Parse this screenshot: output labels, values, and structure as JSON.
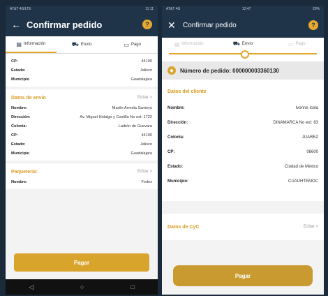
{
  "phone1": {
    "status_left": "AT&T 4G/LTE",
    "status_right": "11:11",
    "title": "Confirmar pedido",
    "tabs": [
      "Información",
      "Envío",
      "Pago"
    ],
    "address_rows": [
      {
        "k": "CP:",
        "v": "44100"
      },
      {
        "k": "Estado:",
        "v": "Jalisco"
      },
      {
        "k": "Municipio",
        "v": "Guadalajara"
      }
    ],
    "envio": {
      "title": "Datos de envío",
      "edit": "Editar >",
      "rows": [
        {
          "k": "Nombre:",
          "v": "Martín Arreola Santoyo"
        },
        {
          "k": "Dirección:",
          "v": "Av. Miguel Hidalgo y Costilla No ext: 1722"
        },
        {
          "k": "Colonia:",
          "v": "Ladrón de Guevara"
        },
        {
          "k": "CP:",
          "v": "44100"
        },
        {
          "k": "Estado:",
          "v": "Jalisco"
        },
        {
          "k": "Municipio",
          "v": "Guadalajara"
        }
      ]
    },
    "paqueteria": {
      "title": "Paquetería:",
      "edit": "Editar >",
      "rows": [
        {
          "k": "Nombre:",
          "v": "Fedex"
        }
      ]
    },
    "pay_label": "Pagar",
    "nav": [
      "◁",
      "○",
      "□"
    ]
  },
  "phone2": {
    "status_left": "AT&T 4G",
    "status_center": "12:47",
    "status_right": "20%",
    "title": "Confirmar pedido",
    "steps": [
      "Información",
      "Envío",
      "Pago"
    ],
    "order_text": "Número de pedido: 000000003360130",
    "cliente": {
      "title": "Datos del cliente",
      "rows": [
        {
          "k": "Nombre:",
          "v": "Ivonne Icela"
        },
        {
          "k": "Dirección:",
          "v": "DINAMARCA No ext: 83"
        },
        {
          "k": "Colonia:",
          "v": "JUAREZ"
        },
        {
          "k": "CP:",
          "v": "06600"
        },
        {
          "k": "Estado:",
          "v": "Ciudad de México"
        },
        {
          "k": "Municipio:",
          "v": "CUAUHTEMOC"
        }
      ]
    },
    "cyc": {
      "title": "Datos de CyC",
      "edit": "Editar >"
    },
    "pay_label": "Pagar"
  }
}
